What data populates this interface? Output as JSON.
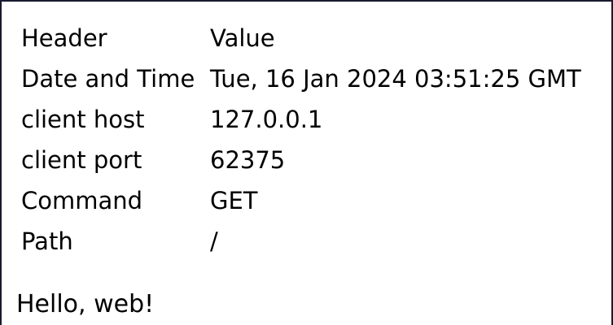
{
  "table": {
    "header": {
      "name": "Header",
      "value": "Value"
    },
    "rows": [
      {
        "name": "Date and Time",
        "value": "Tue, 16 Jan 2024 03:51:25 GMT"
      },
      {
        "name": "client host",
        "value": "127.0.0.1"
      },
      {
        "name": "client port",
        "value": "62375"
      },
      {
        "name": "Command",
        "value": "GET"
      },
      {
        "name": "Path",
        "value": "/"
      }
    ]
  },
  "greeting": "Hello, web!",
  "colors": {
    "text": "#000000",
    "background": "#ffffff",
    "frame": "#1a1a2e"
  }
}
